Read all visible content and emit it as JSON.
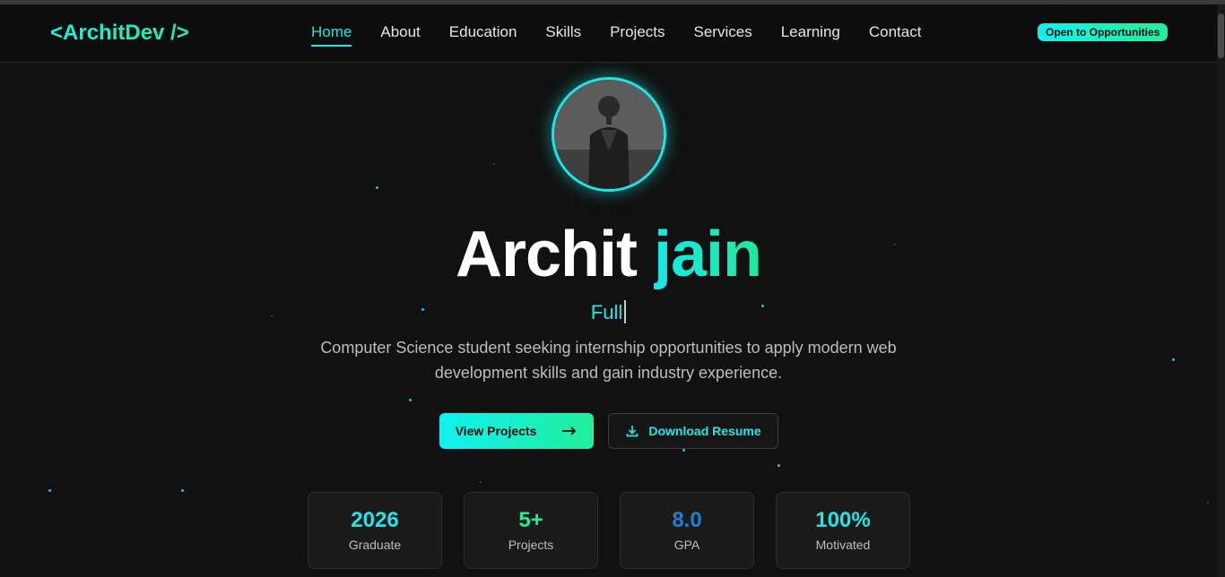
{
  "nav": {
    "logo": "<ArchitDev />",
    "items": [
      {
        "label": "Home",
        "active": true
      },
      {
        "label": "About"
      },
      {
        "label": "Education"
      },
      {
        "label": "Skills"
      },
      {
        "label": "Projects"
      },
      {
        "label": "Services"
      },
      {
        "label": "Learning"
      },
      {
        "label": "Contact"
      }
    ],
    "badge": "Open to Opportunities"
  },
  "hero": {
    "first_name": "Archit",
    "last_name": "jain",
    "typing_text": "Full",
    "description": "Computer Science student seeking internship opportunities to apply modern web development skills and gain industry experience.",
    "primary_button": "View Projects",
    "primary_icon": "arrow-right-icon",
    "secondary_button": "Download Resume",
    "secondary_icon": "download-icon"
  },
  "stats": [
    {
      "value": "2026",
      "label": "Graduate",
      "color": "#22e6e6"
    },
    {
      "value": "5+",
      "label": "Projects",
      "color": "#22ee9a"
    },
    {
      "value": "8.0",
      "label": "GPA",
      "color": "#1f7fd6"
    },
    {
      "value": "100%",
      "label": "Motivated",
      "color": "#22e6e6"
    }
  ],
  "colors": {
    "accent": "#22e6e6",
    "accent2": "#22ee9a",
    "background": "#111111"
  }
}
